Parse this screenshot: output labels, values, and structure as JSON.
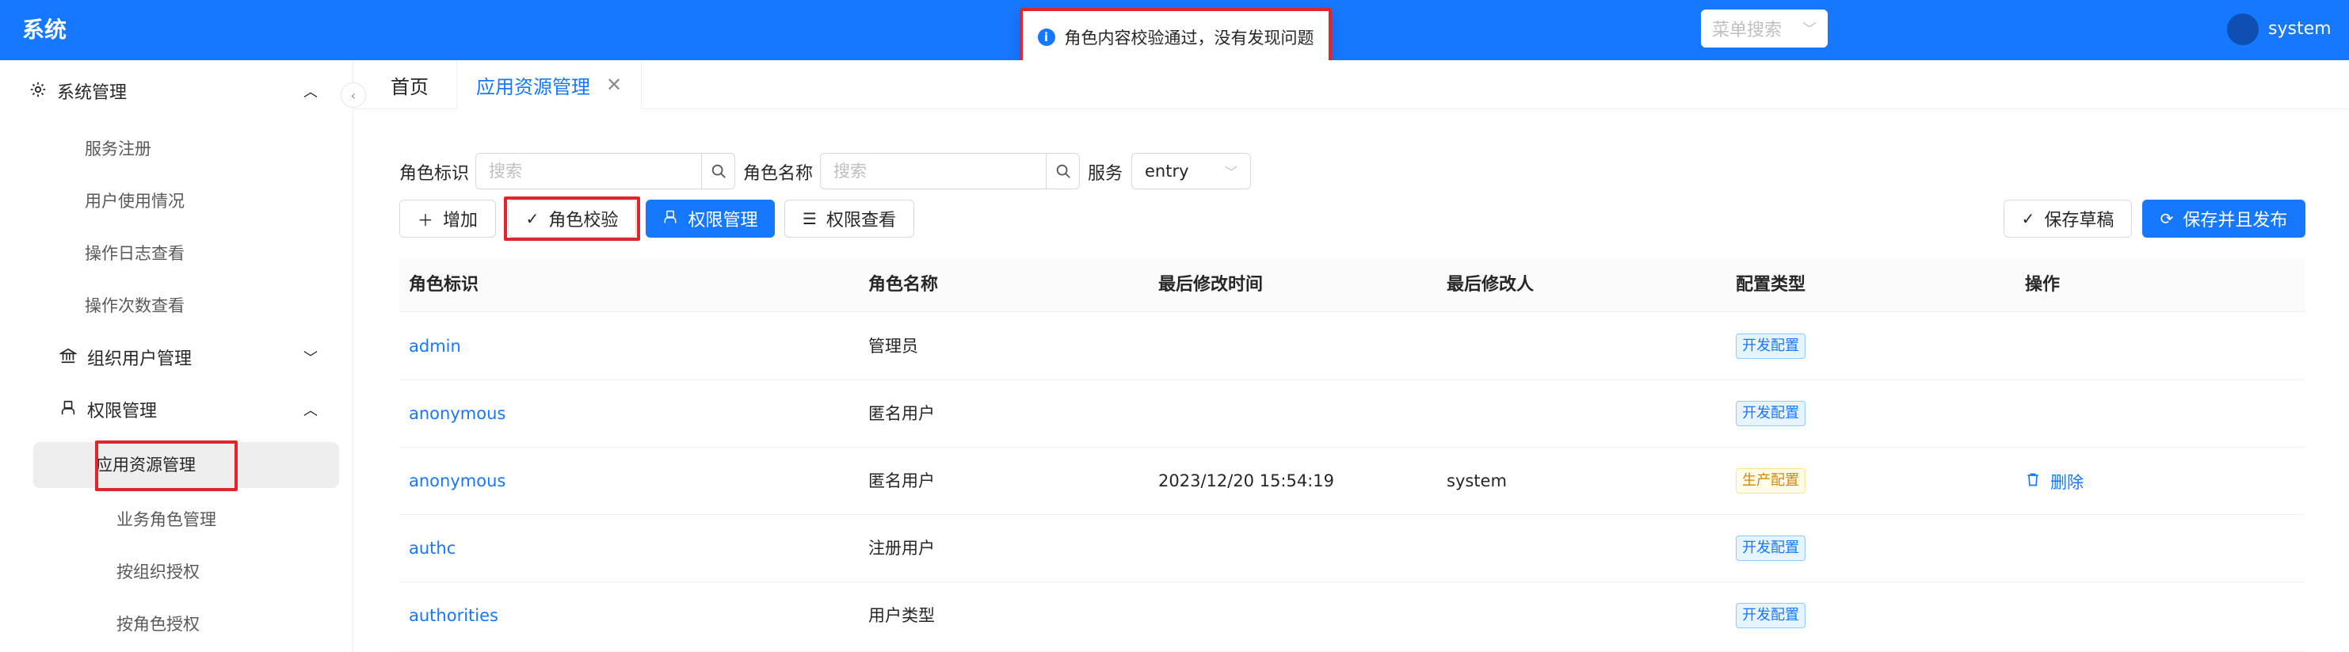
{
  "header": {
    "brand": "系统",
    "menu_search_placeholder": "菜单搜索",
    "username": "system"
  },
  "notification": {
    "message": "角色内容校验通过，没有发现问题"
  },
  "sidebar": {
    "group_system": "系统管理",
    "items": [
      {
        "label": "服务注册"
      },
      {
        "label": "用户使用情况"
      },
      {
        "label": "操作日志查看"
      },
      {
        "label": "操作次数查看"
      }
    ],
    "group_org": "组织用户管理",
    "group_perm": "权限管理",
    "perm_items": [
      {
        "label": "应用资源管理"
      },
      {
        "label": "业务角色管理"
      },
      {
        "label": "按组织授权"
      },
      {
        "label": "按角色授权"
      }
    ]
  },
  "tabs": {
    "home": "首页",
    "active": "应用资源管理"
  },
  "filters": {
    "role_id_label": "角色标识",
    "role_id_placeholder": "搜索",
    "role_name_label": "角色名称",
    "role_name_placeholder": "搜索",
    "service_label": "服务",
    "service_value": "entry"
  },
  "toolbar": {
    "add": "增加",
    "verify": "角色校验",
    "perm_manage": "权限管理",
    "perm_view": "权限查看",
    "save_draft": "保存草稿",
    "save_publish": "保存并且发布"
  },
  "table": {
    "columns": [
      "角色标识",
      "角色名称",
      "最后修改时间",
      "最后修改人",
      "配置类型",
      "操作"
    ],
    "rows": [
      {
        "id": "admin",
        "name": "管理员",
        "time": "",
        "user": "",
        "type": "开发配置",
        "type_kind": "dev",
        "action": ""
      },
      {
        "id": "anonymous",
        "name": "匿名用户",
        "time": "",
        "user": "",
        "type": "开发配置",
        "type_kind": "dev",
        "action": ""
      },
      {
        "id": "anonymous",
        "name": "匿名用户",
        "time": "2023/12/20 15:54:19",
        "user": "system",
        "type": "生产配置",
        "type_kind": "prod",
        "action": "删除"
      },
      {
        "id": "authc",
        "name": "注册用户",
        "time": "",
        "user": "",
        "type": "开发配置",
        "type_kind": "dev",
        "action": ""
      },
      {
        "id": "authorities",
        "name": "用户类型",
        "time": "",
        "user": "",
        "type": "开发配置",
        "type_kind": "dev",
        "action": ""
      }
    ]
  },
  "colors": {
    "primary": "#1677ff",
    "highlight": "#e0262d"
  }
}
